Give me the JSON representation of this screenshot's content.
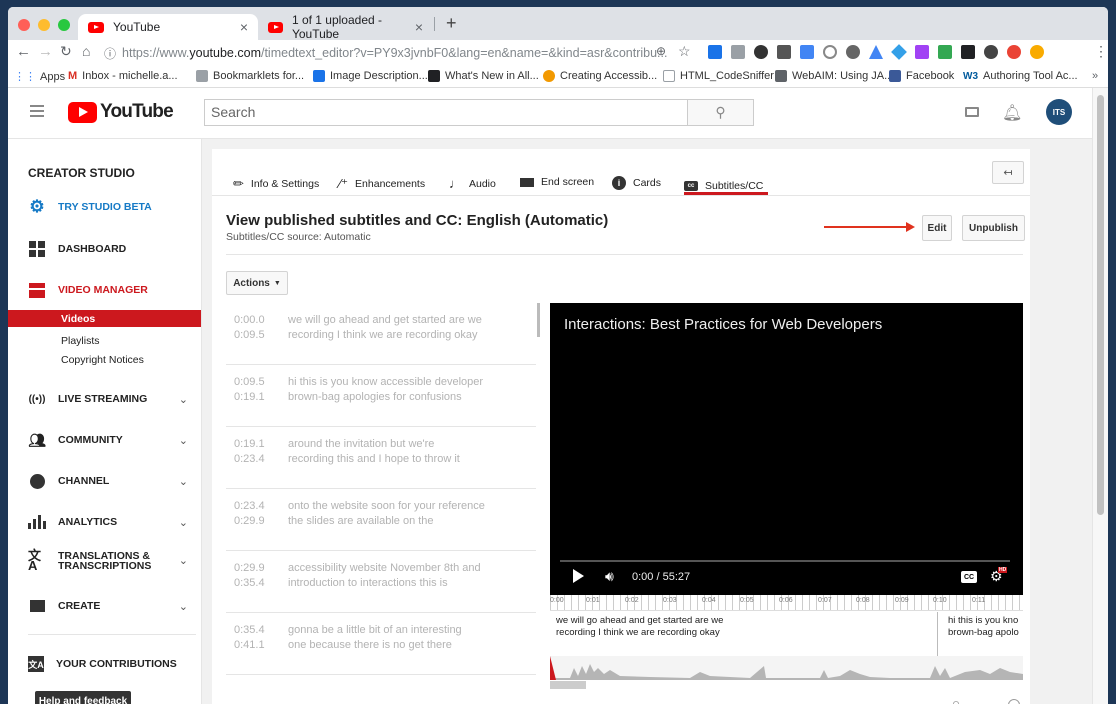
{
  "browser": {
    "tabs": [
      {
        "title": "YouTube",
        "close": "×"
      },
      {
        "title": "1 of 1 uploaded - YouTube",
        "close": "×"
      }
    ],
    "new_tab": "+",
    "url_scheme": "https://www.",
    "url_host": "youtube.com",
    "url_path": "/timedtext_editor?v=PY9x3jvnbF0&lang=en&name=&kind=asr&contribu...",
    "bookmarks": [
      {
        "label": "Apps",
        "color": "#4285f4"
      },
      {
        "label": "Inbox - michelle.a...",
        "color": "#d93025"
      },
      {
        "label": "Bookmarklets for...",
        "color": "#9aa0a6"
      },
      {
        "label": "Image Description...",
        "color": "#1a73e8"
      },
      {
        "label": "What's New in All...",
        "color": "#202124"
      },
      {
        "label": "Creating Accessib...",
        "color": "#f29900"
      },
      {
        "label": "HTML_CodeSniffer",
        "color": "#9aa0a6"
      },
      {
        "label": "WebAIM: Using JA...",
        "color": "#5f6368"
      },
      {
        "label": "Facebook",
        "color": "#3b5998"
      },
      {
        "label": "Authoring Tool Ac...",
        "color": "#005a9c"
      }
    ],
    "more": "»"
  },
  "masthead": {
    "logo_text": "YouTube",
    "search_placeholder": "Search",
    "avatar_text": "ITS"
  },
  "sidebar": {
    "title": "CREATOR STUDIO",
    "try_beta": "TRY STUDIO BETA",
    "items": [
      {
        "label": "DASHBOARD",
        "icon": "dashboard-icon"
      },
      {
        "label": "VIDEO MANAGER",
        "icon": "video-manager-icon"
      },
      {
        "label": "LIVE STREAMING",
        "icon": "live-streaming-icon"
      },
      {
        "label": "COMMUNITY",
        "icon": "community-icon"
      },
      {
        "label": "CHANNEL",
        "icon": "channel-icon"
      },
      {
        "label": "ANALYTICS",
        "icon": "analytics-icon"
      },
      {
        "label": "TRANSLATIONS &",
        "label2": "TRANSCRIPTIONS",
        "icon": "translate-icon"
      },
      {
        "label": "CREATE",
        "icon": "create-icon"
      }
    ],
    "sub_items": [
      "Videos",
      "Playlists",
      "Copyright Notices"
    ],
    "your_contributions": "YOUR CONTRIBUTIONS",
    "help": "Help and feedback"
  },
  "tabs": [
    {
      "label": "Info & Settings",
      "icon": "pencil-icon"
    },
    {
      "label": "Enhancements",
      "icon": "magic-wand-icon"
    },
    {
      "label": "Audio",
      "icon": "music-note-icon"
    },
    {
      "label": "End screen",
      "icon": "end-screen-icon"
    },
    {
      "label": "Cards",
      "icon": "info-icon"
    },
    {
      "label": "Subtitles/CC",
      "icon": "cc-icon"
    }
  ],
  "editor": {
    "heading": "View published subtitles and CC: English (Automatic)",
    "source": "Subtitles/CC source: Automatic",
    "edit": "Edit",
    "unpublish": "Unpublish",
    "actions": "Actions"
  },
  "captions": [
    {
      "start": "0:00.0",
      "end": "0:09.5",
      "line1": "we will go ahead and get started are we",
      "line2": "recording I think we are recording okay"
    },
    {
      "start": "0:09.5",
      "end": "0:19.1",
      "line1": "hi this is you know accessible developer",
      "line2": "brown-bag apologies for confusions"
    },
    {
      "start": "0:19.1",
      "end": "0:23.4",
      "line1": "around the invitation but we're",
      "line2": "recording this and I hope to throw it"
    },
    {
      "start": "0:23.4",
      "end": "0:29.9",
      "line1": "onto the website soon for your reference",
      "line2": "the slides are available on the"
    },
    {
      "start": "0:29.9",
      "end": "0:35.4",
      "line1": "accessibility website November 8th and",
      "line2": "introduction to interactions this is"
    },
    {
      "start": "0:35.4",
      "end": "0:41.1",
      "line1": "gonna be a little bit of an interesting",
      "line2": "one because there is no get there"
    }
  ],
  "player": {
    "title": "Interactions: Best Practices for Web Developers",
    "time": "0:00 / 55:27",
    "cc": "CC",
    "hd": "HD",
    "progress": 0
  },
  "timeline": {
    "ticks": [
      "0:00",
      "0:01",
      "0:02",
      "0:03",
      "0:04",
      "0:05",
      "0:06",
      "0:07",
      "0:08",
      "0:09",
      "0:10",
      "0:11"
    ],
    "cap1_line1": "we will go ahead and get started are we",
    "cap1_line2": "recording I think we are recording okay",
    "cap2_line1": "hi this is you kno",
    "cap2_line2": "brown-bag apolo"
  }
}
